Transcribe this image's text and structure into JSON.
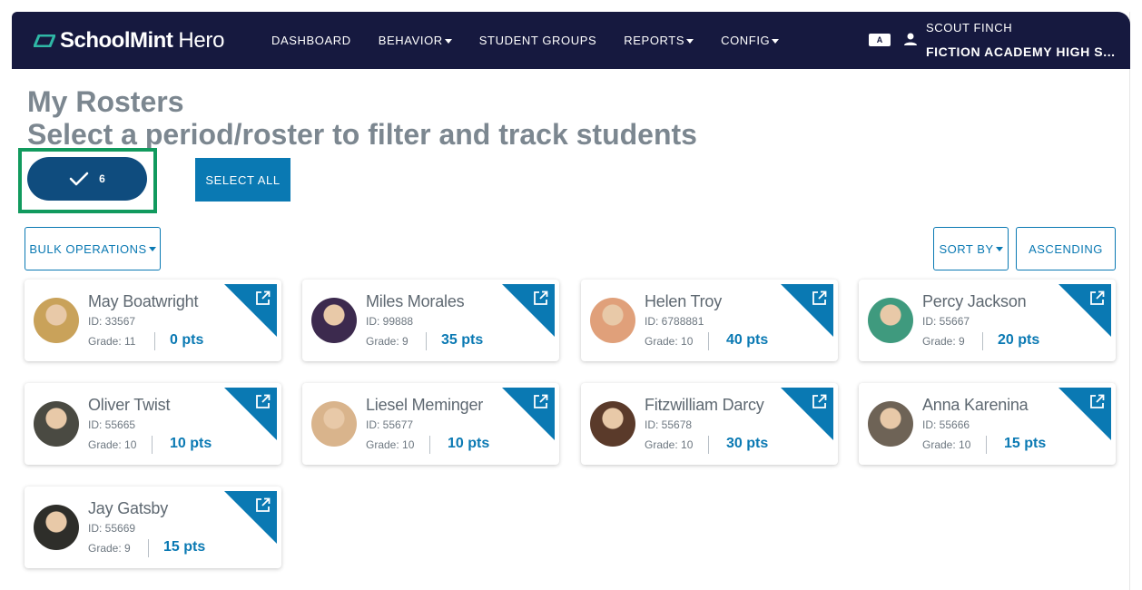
{
  "brand": {
    "name": "SchoolMint",
    "product": "Hero"
  },
  "nav": [
    {
      "label": "DASHBOARD",
      "dropdown": false
    },
    {
      "label": "BEHAVIOR",
      "dropdown": true
    },
    {
      "label": "STUDENT GROUPS",
      "dropdown": false
    },
    {
      "label": "REPORTS",
      "dropdown": true
    },
    {
      "label": "CONFIG",
      "dropdown": true
    }
  ],
  "translate_icon_text": "A",
  "user": {
    "name": "SCOUT FINCH",
    "school": "FICTION ACADEMY HIGH S..."
  },
  "page": {
    "title": "My Rosters",
    "subtitle": "Select a period/roster to filter and track students"
  },
  "roster_pill": {
    "count": "6"
  },
  "buttons": {
    "select_all": "SELECT ALL",
    "bulk_operations": "BULK OPERATIONS",
    "sort_by": "SORT BY",
    "ascending": "ASCENDING"
  },
  "students": [
    {
      "name": "May Boatwright",
      "id": "ID: 33567",
      "grade": "Grade: 11",
      "points": "0 pts",
      "avatar_color": "#c9a25a"
    },
    {
      "name": "Miles Morales",
      "id": "ID: 99888",
      "grade": "Grade: 9",
      "points": "35 pts",
      "avatar_color": "#3c2a4e"
    },
    {
      "name": "Helen Troy",
      "id": "ID: 6788881",
      "grade": "Grade: 10",
      "points": "40 pts",
      "avatar_color": "#e0a07a"
    },
    {
      "name": "Percy Jackson",
      "id": "ID: 55667",
      "grade": "Grade: 9",
      "points": "20 pts",
      "avatar_color": "#3f9a7e"
    },
    {
      "name": "Oliver Twist",
      "id": "ID: 55665",
      "grade": "Grade: 10",
      "points": "10 pts",
      "avatar_color": "#4a4a42"
    },
    {
      "name": "Liesel Meminger",
      "id": "ID: 55677",
      "grade": "Grade: 10",
      "points": "10 pts",
      "avatar_color": "#d9b48c"
    },
    {
      "name": "Fitzwilliam Darcy",
      "id": "ID: 55678",
      "grade": "Grade: 10",
      "points": "30 pts",
      "avatar_color": "#5a3a2a"
    },
    {
      "name": "Anna Karenina",
      "id": "ID: 55666",
      "grade": "Grade: 10",
      "points": "15 pts",
      "avatar_color": "#6e6356"
    },
    {
      "name": "Jay Gatsby",
      "id": "ID: 55669",
      "grade": "Grade: 9",
      "points": "15 pts",
      "avatar_color": "#2e2e2a"
    }
  ],
  "colors": {
    "nav_bg": "#16193f",
    "accent_blue": "#0a79b3",
    "pill_blue": "#0f4c7e",
    "highlight_green": "#119a5e",
    "heading_gray": "#7c8790"
  }
}
